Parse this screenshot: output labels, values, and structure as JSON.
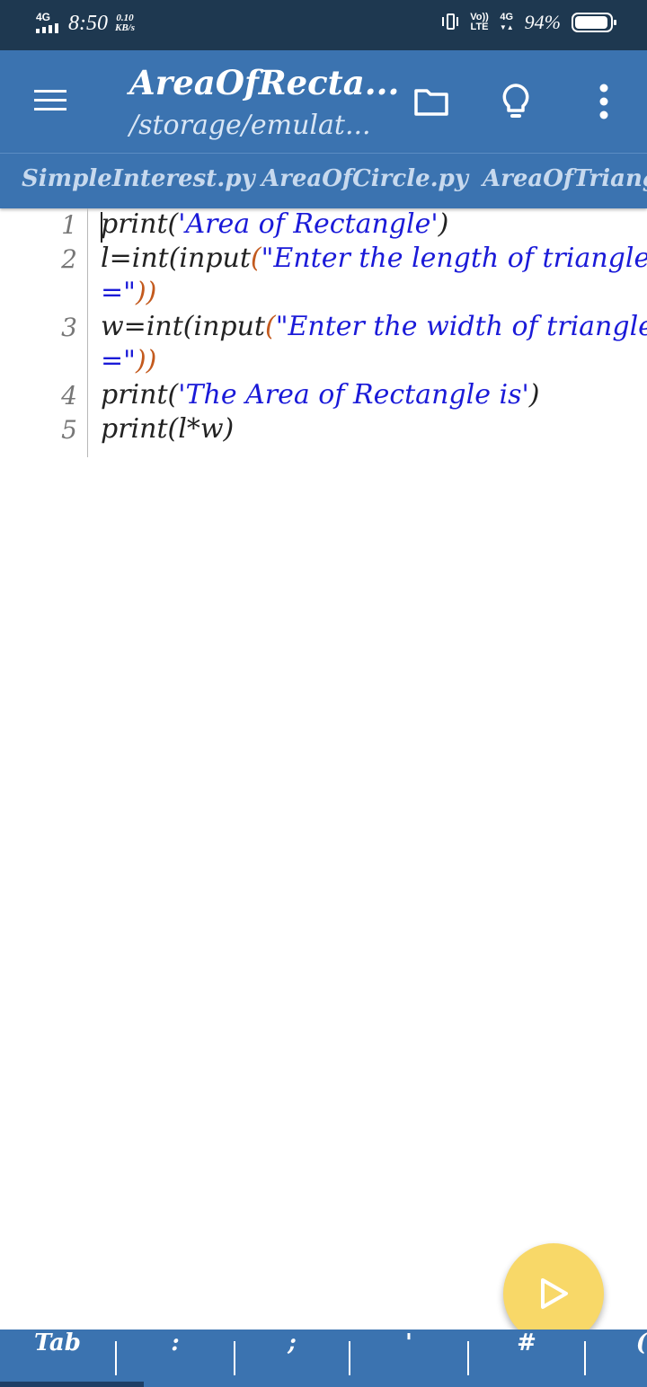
{
  "status_bar": {
    "network_left": "4G",
    "time": "8:50",
    "speed_value": "0.10",
    "speed_unit": "KB/s",
    "volte": "Vo))",
    "volte_sub": "LTE",
    "network_right": "4G",
    "battery_percent": "94%",
    "battery_level": 0.94
  },
  "app_bar": {
    "title": "AreaOfRecta...",
    "subtitle": "/storage/emulat...",
    "icons": [
      "menu-icon",
      "folder-icon",
      "lightbulb-icon",
      "more-vert-icon"
    ]
  },
  "tabs": [
    {
      "label": "SimpleInterest.py"
    },
    {
      "label": "AreaOfCircle.py"
    },
    {
      "label": "AreaOfTriangle"
    }
  ],
  "editor": {
    "line_numbers": [
      "1",
      "2",
      "3",
      "4",
      "5"
    ],
    "lines": [
      {
        "pre": "print(",
        "str": "'Area of Rectangle'",
        "post": ")"
      },
      {
        "pre": "l=int(input",
        "paren": "(",
        "str": "\"Enter the length of triangle",
        "cont_str": "=\"",
        "cont_post": "))"
      },
      {
        "pre": "w=int(input",
        "paren": "(",
        "str": "\"Enter the width of triangle",
        "cont_str": "=\"",
        "cont_post": "))"
      },
      {
        "pre": "print(",
        "str": "'The Area of Rectangle is'",
        "post": ")"
      },
      {
        "pre": "print(l*w)"
      }
    ]
  },
  "fab": {
    "icon": "play-icon"
  },
  "keybar": {
    "keys": [
      "Tab",
      ":",
      ";",
      "'",
      "#",
      "("
    ]
  },
  "colors": {
    "status_bar": "#1e3850",
    "app_bar": "#3b73b0",
    "string": "#1a1ad8",
    "paren_highlight": "#c35a1e",
    "fab": "#f8d868"
  }
}
